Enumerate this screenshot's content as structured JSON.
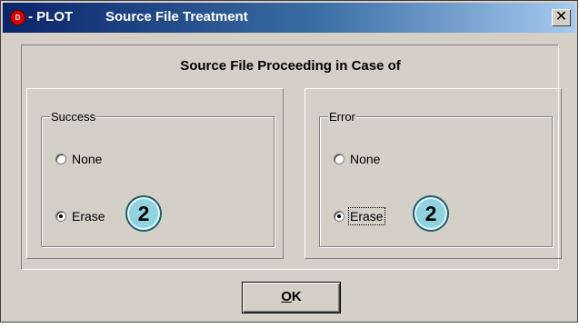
{
  "window": {
    "icon_text": "D",
    "title_prefix": "- PLOT",
    "title": "Source File Treatment",
    "close_glyph": "✕"
  },
  "dialog": {
    "heading": "Source File Proceeding in Case of"
  },
  "success_group": {
    "label": "Success",
    "options": [
      {
        "label": "None",
        "checked": false
      },
      {
        "label": "Erase",
        "checked": true
      }
    ],
    "badge": "2"
  },
  "error_group": {
    "label": "Error",
    "options": [
      {
        "label": "None",
        "checked": false
      },
      {
        "label": "Erase",
        "checked": true
      }
    ],
    "badge": "2"
  },
  "buttons": {
    "ok_mnemonic": "O",
    "ok_rest": "K"
  }
}
